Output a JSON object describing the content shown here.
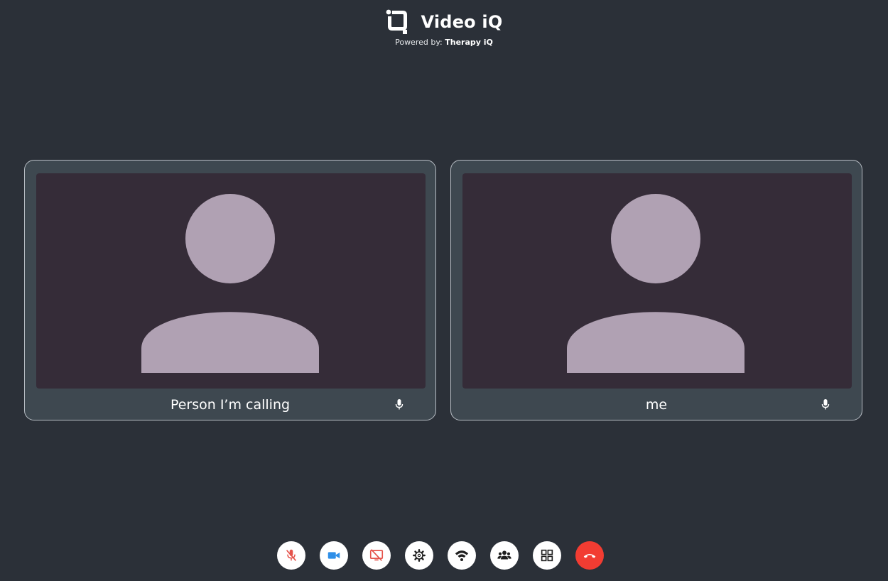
{
  "header": {
    "app_name": "Video iQ",
    "powered_by_prefix": "Powered by:",
    "powered_by_brand": "Therapy iQ",
    "logo_icon": "iq-logo-icon"
  },
  "participants": [
    {
      "name": "Person I’m calling",
      "avatar_icon": "person-placeholder-icon",
      "mic_icon": "microphone-icon"
    },
    {
      "name": "me",
      "avatar_icon": "person-placeholder-icon",
      "mic_icon": "microphone-icon"
    }
  ],
  "toolbar": {
    "buttons": [
      {
        "id": "mute",
        "icon": "microphone-off-icon",
        "color": "#e5534b",
        "state": "muted"
      },
      {
        "id": "camera",
        "icon": "video-camera-icon",
        "color": "#2f8fe8",
        "state": "on"
      },
      {
        "id": "screen-share",
        "icon": "screen-share-off-icon",
        "color": "#e5534b",
        "state": "off"
      },
      {
        "id": "settings",
        "icon": "gear-icon",
        "color": "#1e1e1e"
      },
      {
        "id": "network",
        "icon": "wifi-icon",
        "color": "#1e1e1e"
      },
      {
        "id": "participants",
        "icon": "people-icon",
        "color": "#1e1e1e"
      },
      {
        "id": "layout",
        "icon": "grid-icon",
        "color": "#1e1e1e"
      },
      {
        "id": "hang-up",
        "icon": "phone-hangup-icon",
        "color": "#f23c32"
      }
    ]
  },
  "colors": {
    "background": "#2b3038",
    "tile": "#3e4850",
    "video_area": "#352c38",
    "avatar": "#b0a1b3"
  }
}
